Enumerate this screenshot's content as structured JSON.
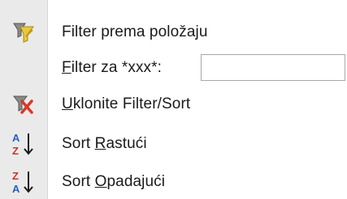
{
  "menu": {
    "items": [
      {
        "icon": "filter-by-selection-icon",
        "label": "Filter prema položaju"
      },
      {
        "icon": "none",
        "label_access": "F",
        "label_rest": "ilter za *xxx*:",
        "input_value": "",
        "input_placeholder": ""
      },
      {
        "icon": "remove-filter-icon",
        "label_access": "U",
        "label_rest": "klonite Filter/Sort"
      },
      {
        "icon": "sort-ascending-icon",
        "label_pre": "Sort ",
        "label_access": "R",
        "label_rest": "astući"
      },
      {
        "icon": "sort-descending-icon",
        "label_pre": "Sort ",
        "label_access": "O",
        "label_rest": "padajući"
      }
    ],
    "icon_letters": {
      "a": "A",
      "z": "Z"
    }
  },
  "colors": {
    "gutter": "#eaeaea",
    "funnel_yellow": "#e8c840",
    "funnel_gray": "#8a8a8a",
    "remove_red": "#d23a2a",
    "sort_a_blue": "#2a5fc0",
    "sort_z_red": "#c0392b",
    "arrow_black": "#1a1a1a"
  }
}
